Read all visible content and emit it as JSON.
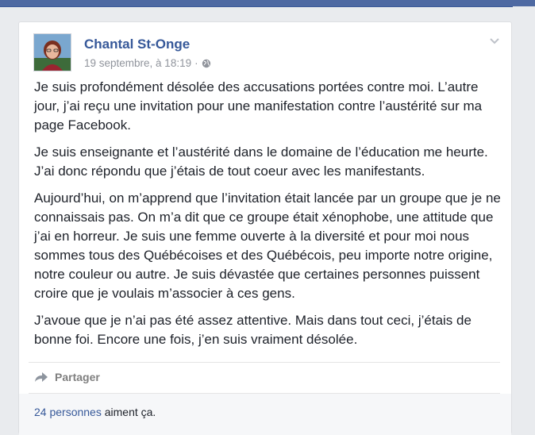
{
  "post": {
    "author": "Chantal St-Onge",
    "date": "19 septembre, à 18:19",
    "separator": "·",
    "paragraphs": [
      "Je suis profondément désolée des accusations portées contre moi. L’autre jour, j’ai reçu une invitation pour une manifestation contre l’austérité sur ma page Facebook.",
      "Je suis enseignante et l’austérité dans le domaine de l’éducation me heurte. J’ai donc répondu que j’étais de tout coeur avec les manifestants.",
      "Aujourd’hui, on m’apprend que l’invitation était lancée par un groupe que je ne connaissais pas. On m’a dit que ce groupe était xénophobe, une attitude que j’ai en horreur. Je suis une femme ouverte à la diversité et pour moi nous sommes tous des Québécoises et des Québécois, peu importe notre origine, notre couleur ou autre. Je suis dévastée que certaines personnes puissent croire que je voulais m’associer à ces gens.",
      "J’avoue que je n’ai pas été assez attentive. Mais dans tout ceci, j’étais de bonne foi. Encore une fois, j’en suis vraiment désolée."
    ],
    "share_label": "Partager",
    "likes_count_link": "24 personnes",
    "likes_suffix": " aiment ça."
  },
  "colors": {
    "brand_blue": "#365899",
    "topbar": "#4e69a2",
    "text": "#1d2129",
    "meta": "#90949c"
  },
  "icons": {
    "avatar": "avatar-photo",
    "globe": "globe-icon",
    "chevron": "chevron-down-icon",
    "share": "share-arrow-icon"
  }
}
